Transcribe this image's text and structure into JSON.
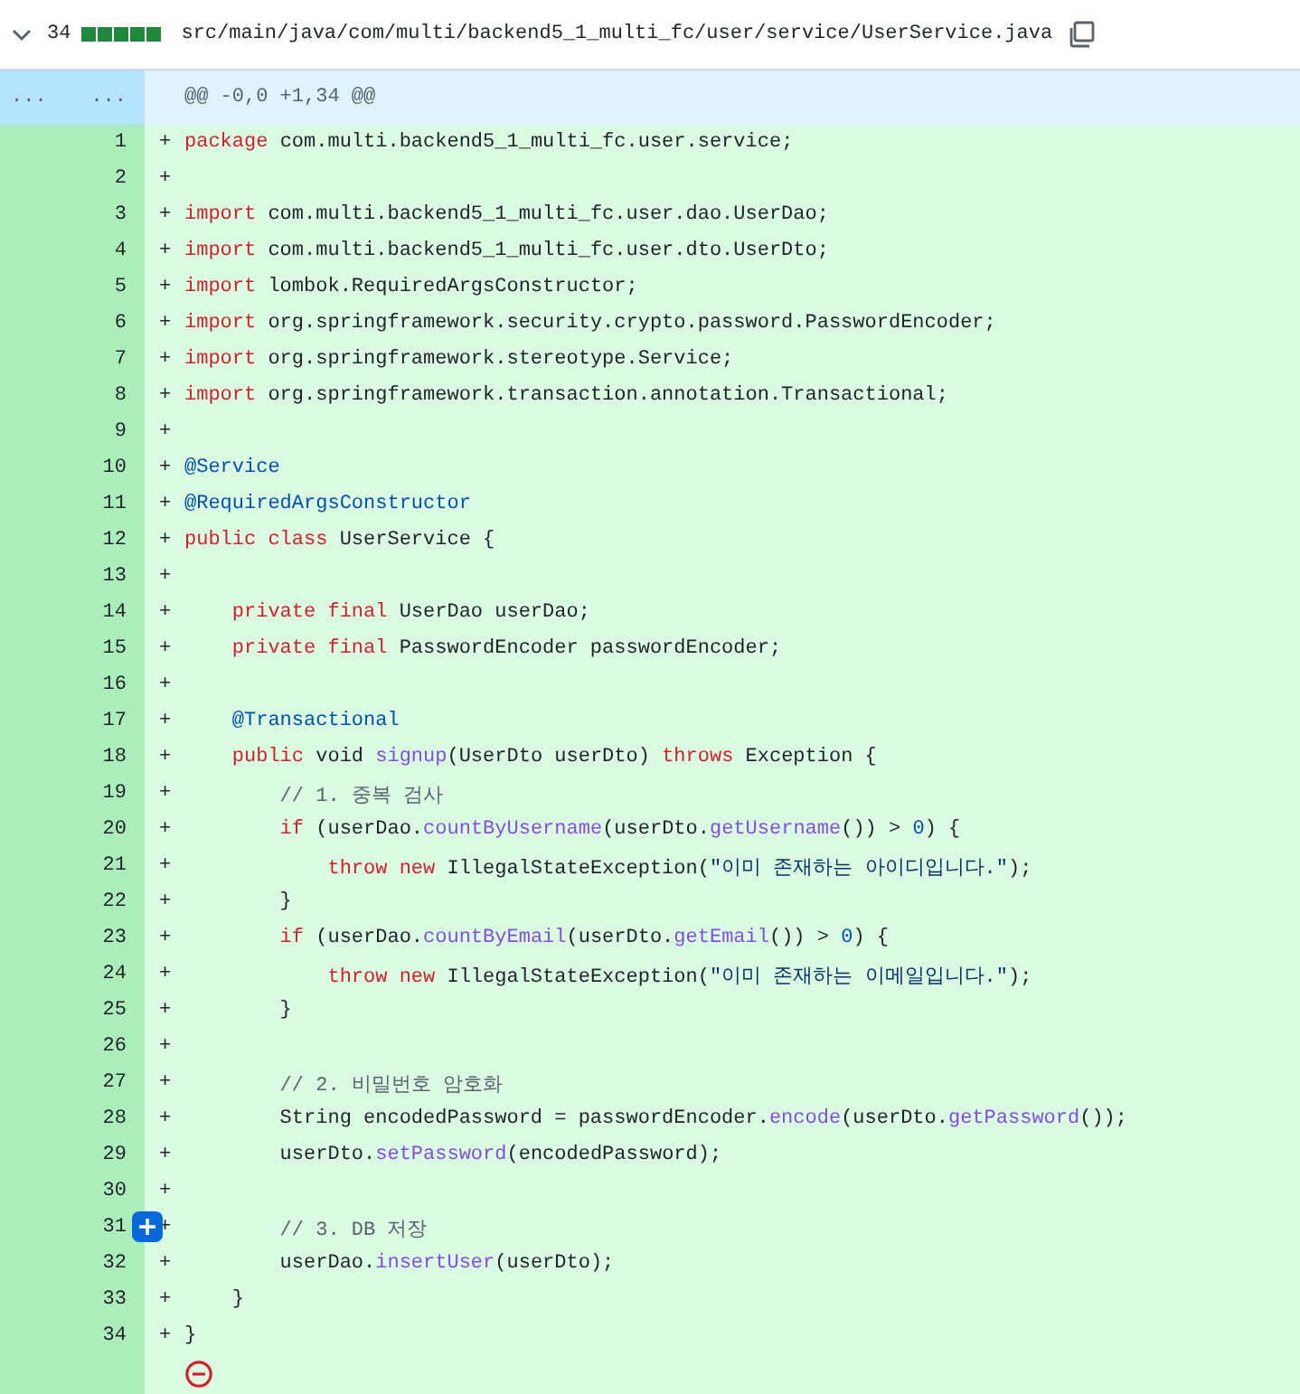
{
  "file_header": {
    "expanded": true,
    "changes": "34",
    "diffstat": {
      "level": 1
    },
    "path": "src/main/java/com/multi/backend5_1_multi_fc/user/service/UserService.java"
  },
  "hunk": {
    "old_marker": "...",
    "new_marker": "...",
    "text": "@@ -0,0 +1,34 @@"
  },
  "lines": [
    {
      "number": "1",
      "sign": "+",
      "tokens": [
        {
          "kind": "keyword",
          "text": "package"
        },
        {
          "kind": "plain",
          "text": " com.multi.backend5_1_multi_fc.user.service;"
        }
      ]
    },
    {
      "number": "2",
      "sign": "+"
    },
    {
      "number": "3",
      "sign": "+",
      "tokens": [
        {
          "kind": "keyword",
          "text": "import"
        },
        {
          "kind": "plain",
          "text": " com.multi.backend5_1_multi_fc.user.dao.UserDao;"
        }
      ]
    },
    {
      "number": "4",
      "sign": "+",
      "tokens": [
        {
          "kind": "keyword",
          "text": "import"
        },
        {
          "kind": "plain",
          "text": " com.multi.backend5_1_multi_fc.user.dto.UserDto;"
        }
      ]
    },
    {
      "number": "5",
      "sign": "+",
      "tokens": [
        {
          "kind": "keyword",
          "text": "import"
        },
        {
          "kind": "plain",
          "text": " lombok.RequiredArgsConstructor;"
        }
      ]
    },
    {
      "number": "6",
      "sign": "+",
      "tokens": [
        {
          "kind": "keyword",
          "text": "import"
        },
        {
          "kind": "plain",
          "text": " org.springframework.security.crypto.password.PasswordEncoder;"
        }
      ]
    },
    {
      "number": "7",
      "sign": "+",
      "tokens": [
        {
          "kind": "keyword",
          "text": "import"
        },
        {
          "kind": "plain",
          "text": " org.springframework.stereotype.Service;"
        }
      ]
    },
    {
      "number": "8",
      "sign": "+",
      "tokens": [
        {
          "kind": "keyword",
          "text": "import"
        },
        {
          "kind": "plain",
          "text": " org.springframework.transaction.annotation.Transactional;"
        }
      ]
    },
    {
      "number": "9",
      "sign": "+"
    },
    {
      "number": "10",
      "sign": "+",
      "tokens": [
        {
          "kind": "annotation",
          "text": "@Service"
        }
      ]
    },
    {
      "number": "11",
      "sign": "+",
      "tokens": [
        {
          "kind": "annotation",
          "text": "@RequiredArgsConstructor"
        }
      ]
    },
    {
      "number": "12",
      "sign": "+",
      "tokens": [
        {
          "kind": "keyword",
          "text": "public class"
        },
        {
          "kind": "plain",
          "text": " UserService {"
        }
      ]
    },
    {
      "number": "13",
      "sign": "+"
    },
    {
      "number": "14",
      "sign": "+",
      "tokens": [
        {
          "kind": "keyword",
          "text": "    private final"
        },
        {
          "kind": "plain",
          "text": " UserDao userDao;"
        }
      ]
    },
    {
      "number": "15",
      "sign": "+",
      "tokens": [
        {
          "kind": "keyword",
          "text": "    private final"
        },
        {
          "kind": "plain",
          "text": " PasswordEncoder passwordEncoder;"
        }
      ]
    },
    {
      "number": "16",
      "sign": "+"
    },
    {
      "number": "17",
      "sign": "+",
      "tokens": [
        {
          "kind": "annotation",
          "text": "    @Transactional"
        }
      ]
    },
    {
      "number": "18",
      "sign": "+",
      "tokens": [
        {
          "kind": "keyword",
          "text": "    public"
        },
        {
          "kind": "plain",
          "text": " void "
        },
        {
          "kind": "function",
          "text": "signup"
        },
        {
          "kind": "plain",
          "text": "(UserDto userDto) "
        },
        {
          "kind": "keyword",
          "text": "throws"
        },
        {
          "kind": "plain",
          "text": " Exception {"
        }
      ]
    },
    {
      "number": "19",
      "sign": "+",
      "tokens": [
        {
          "kind": "comment",
          "text": "        // 1. 중복 검사"
        }
      ]
    },
    {
      "number": "20",
      "sign": "+",
      "tokens": [
        {
          "kind": "keyword",
          "text": "        if"
        },
        {
          "kind": "plain",
          "text": " (userDao."
        },
        {
          "kind": "function",
          "text": "countByUsername"
        },
        {
          "kind": "plain",
          "text": "(userDto."
        },
        {
          "kind": "function",
          "text": "getUsername"
        },
        {
          "kind": "plain",
          "text": "()) > "
        },
        {
          "kind": "number",
          "text": "0"
        },
        {
          "kind": "plain",
          "text": ") {"
        }
      ]
    },
    {
      "number": "21",
      "sign": "+",
      "tokens": [
        {
          "kind": "keyword",
          "text": "            throw new"
        },
        {
          "kind": "plain",
          "text": " IllegalStateException("
        },
        {
          "kind": "string",
          "text": "\"이미 존재하는 아이디입니다.\""
        },
        {
          "kind": "plain",
          "text": ");"
        }
      ]
    },
    {
      "number": "22",
      "sign": "+",
      "tokens": [
        {
          "kind": "plain",
          "text": "        }"
        }
      ]
    },
    {
      "number": "23",
      "sign": "+",
      "tokens": [
        {
          "kind": "keyword",
          "text": "        if"
        },
        {
          "kind": "plain",
          "text": " (userDao."
        },
        {
          "kind": "function",
          "text": "countByEmail"
        },
        {
          "kind": "plain",
          "text": "(userDto."
        },
        {
          "kind": "function",
          "text": "getEmail"
        },
        {
          "kind": "plain",
          "text": "()) > "
        },
        {
          "kind": "number",
          "text": "0"
        },
        {
          "kind": "plain",
          "text": ") {"
        }
      ]
    },
    {
      "number": "24",
      "sign": "+",
      "tokens": [
        {
          "kind": "keyword",
          "text": "            throw new"
        },
        {
          "kind": "plain",
          "text": " IllegalStateException("
        },
        {
          "kind": "string",
          "text": "\"이미 존재하는 이메일입니다.\""
        },
        {
          "kind": "plain",
          "text": ");"
        }
      ]
    },
    {
      "number": "25",
      "sign": "+",
      "tokens": [
        {
          "kind": "plain",
          "text": "        }"
        }
      ]
    },
    {
      "number": "26",
      "sign": "+"
    },
    {
      "number": "27",
      "sign": "+",
      "tokens": [
        {
          "kind": "comment",
          "text": "        // 2. 비밀번호 암호화"
        }
      ]
    },
    {
      "number": "28",
      "sign": "+",
      "tokens": [
        {
          "kind": "plain",
          "text": "        String encodedPassword = passwordEncoder."
        },
        {
          "kind": "function",
          "text": "encode"
        },
        {
          "kind": "plain",
          "text": "(userDto."
        },
        {
          "kind": "function",
          "text": "getPassword"
        },
        {
          "kind": "plain",
          "text": "());"
        }
      ]
    },
    {
      "number": "29",
      "sign": "+",
      "tokens": [
        {
          "kind": "plain",
          "text": "        userDto."
        },
        {
          "kind": "function",
          "text": "setPassword"
        },
        {
          "kind": "plain",
          "text": "(encodedPassword);"
        }
      ]
    },
    {
      "number": "30",
      "sign": "+"
    },
    {
      "number": "31",
      "sign": "+",
      "tokens": [
        {
          "kind": "comment",
          "text": "        // 3. DB 저장"
        }
      ],
      "comment_button": true
    },
    {
      "number": "32",
      "sign": "+",
      "tokens": [
        {
          "kind": "plain",
          "text": "        userDao."
        },
        {
          "kind": "function",
          "text": "insertUser"
        },
        {
          "kind": "plain",
          "text": "(userDto);"
        }
      ]
    },
    {
      "number": "33",
      "sign": "+",
      "tokens": [
        {
          "kind": "plain",
          "text": "    }"
        }
      ]
    },
    {
      "number": "34",
      "sign": "+",
      "tokens": [
        {
          "kind": "plain",
          "text": "}"
        }
      ]
    }
  ],
  "no_newline_marker": true
}
